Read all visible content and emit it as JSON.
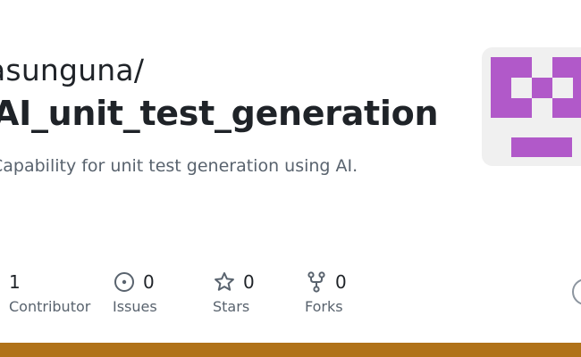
{
  "repo": {
    "owner": "asunguna/",
    "name": "AI_unit_test_generation",
    "description": "Capability for unit test generation using AI."
  },
  "stats": [
    {
      "count": "1",
      "label": "Contributor",
      "icon": "contributor-icon"
    },
    {
      "count": "0",
      "label": "Issues",
      "icon": "issue-icon"
    },
    {
      "count": "0",
      "label": "Stars",
      "icon": "star-icon"
    },
    {
      "count": "0",
      "label": "Forks",
      "icon": "fork-icon"
    }
  ],
  "colors": {
    "avatar": "#b159c9",
    "avatar_bg": "#f0f0f0",
    "language_bar": "#b07219",
    "icon": "#59636e"
  }
}
